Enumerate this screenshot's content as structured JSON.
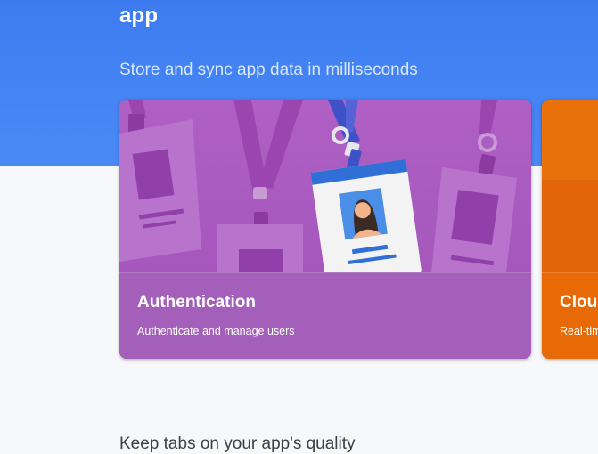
{
  "hero": {
    "title": "app",
    "subtitle": "Store and sync app data in milliseconds"
  },
  "cards": [
    {
      "title": "Authentication",
      "description": "Authenticate and manage users",
      "illustration": "id-badges-illustration",
      "color": "#a55fbf"
    },
    {
      "title": "Clou",
      "description": "Real-tim",
      "illustration": "cloud-illustration",
      "color": "#e8710a"
    }
  ],
  "sections": {
    "quality_heading": "Keep tabs on your app's quality"
  },
  "colors": {
    "hero_blue": "#4285f4",
    "page_background": "#f7f8fa"
  }
}
